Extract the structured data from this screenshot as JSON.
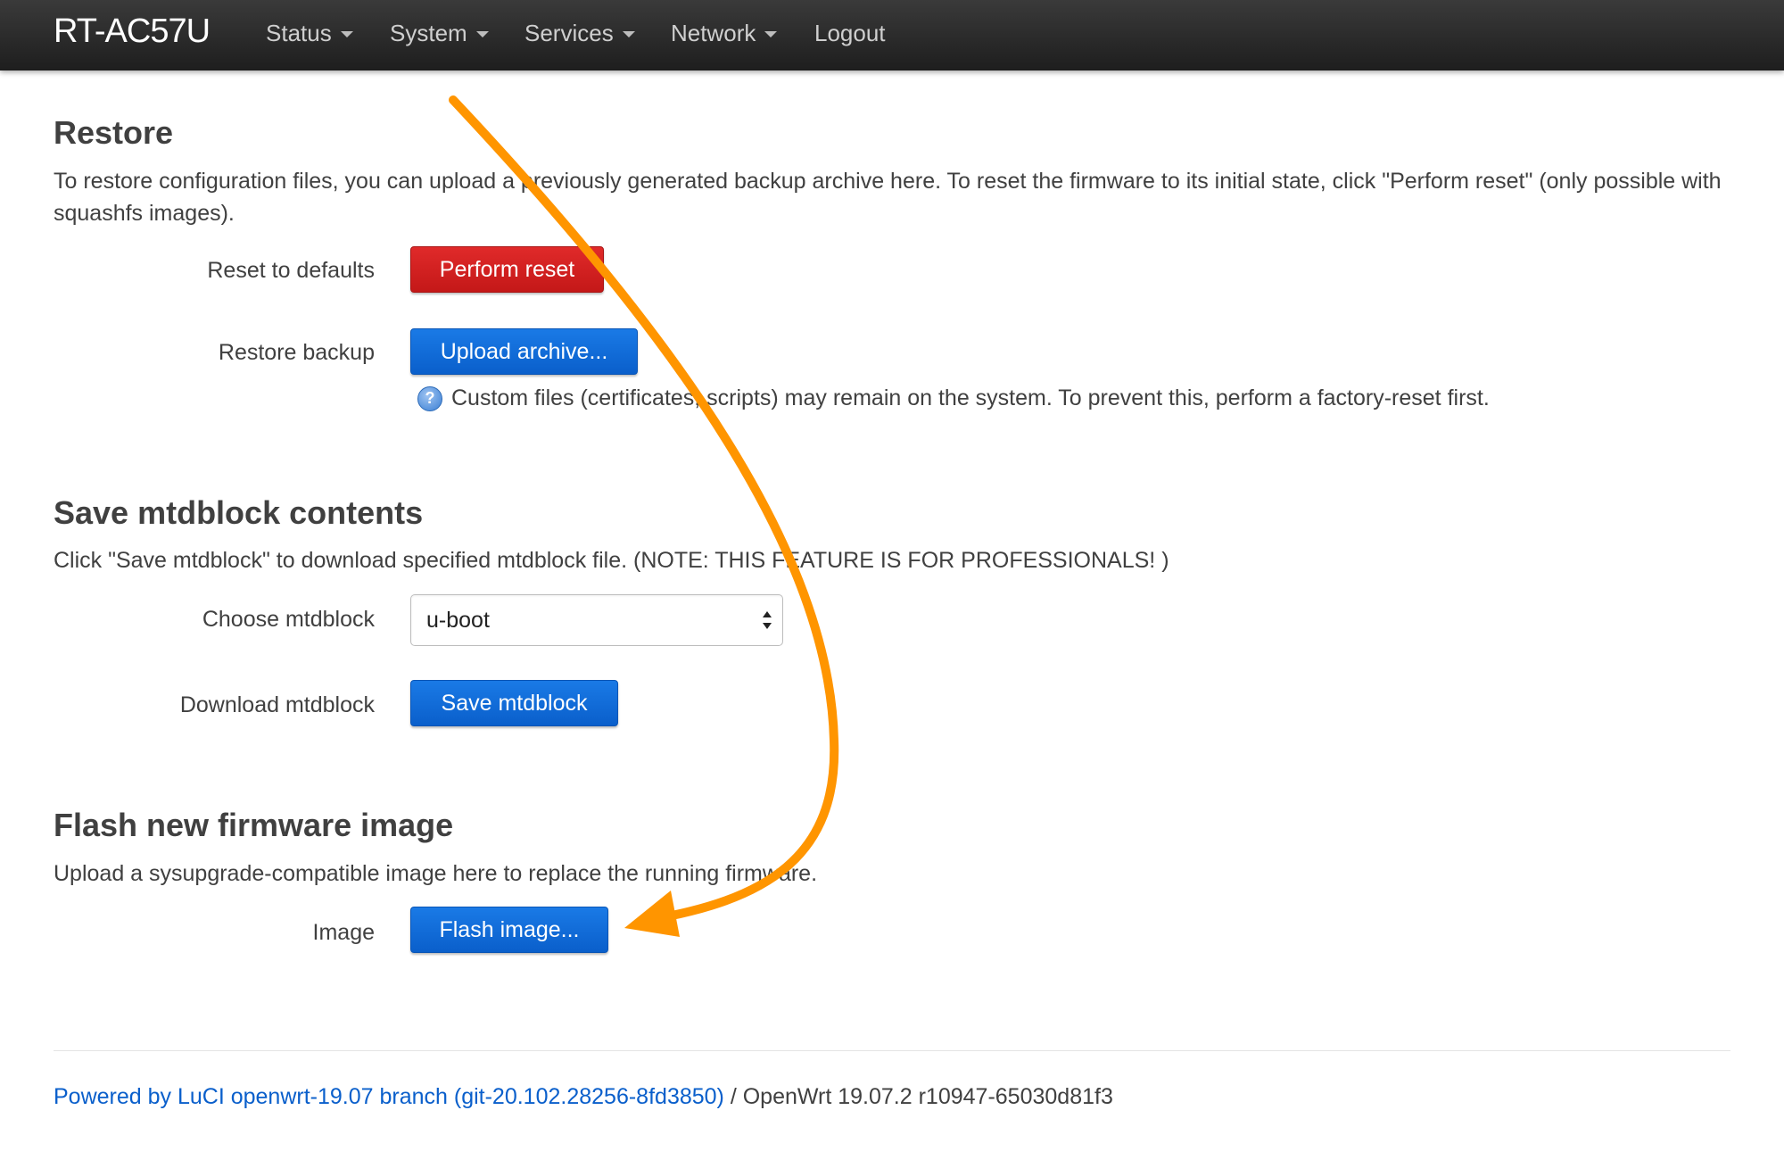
{
  "header": {
    "brand": "RT-AC57U",
    "menu": [
      {
        "label": "Status",
        "has_dropdown": true
      },
      {
        "label": "System",
        "has_dropdown": true
      },
      {
        "label": "Services",
        "has_dropdown": true
      },
      {
        "label": "Network",
        "has_dropdown": true
      },
      {
        "label": "Logout",
        "has_dropdown": false
      }
    ]
  },
  "restore": {
    "title": "Restore",
    "description": "To restore configuration files, you can upload a previously generated backup archive here. To reset the firmware to its initial state, click \"Perform reset\" (only possible with squashfs images).",
    "reset_label": "Reset to defaults",
    "reset_button": "Perform reset",
    "backup_label": "Restore backup",
    "upload_button": "Upload archive...",
    "help_text": "Custom files (certificates, scripts) may remain on the system. To prevent this, perform a factory-reset first.",
    "help_icon": "help-icon"
  },
  "mtdblock": {
    "title": "Save mtdblock contents",
    "description": "Click \"Save mtdblock\" to download specified mtdblock file. (NOTE: THIS FEATURE IS FOR PROFESSIONALS! )",
    "choose_label": "Choose mtdblock",
    "selected": "u-boot",
    "download_label": "Download mtdblock",
    "save_button": "Save mtdblock"
  },
  "flash": {
    "title": "Flash new firmware image",
    "description": "Upload a sysupgrade-compatible image here to replace the running firmware.",
    "image_label": "Image",
    "flash_button": "Flash image..."
  },
  "footer": {
    "link_text": "Powered by LuCI openwrt-19.07 branch (git-20.102.28256-8fd3850)",
    "version_text": " / OpenWrt 19.07.2 r10947-65030d81f3"
  },
  "colors": {
    "navbar": "#262626",
    "primary_button": "#0a5fcb",
    "danger_button": "#cc1e1e",
    "annotation_arrow": "#ff9500",
    "link": "#0a5fcb"
  }
}
